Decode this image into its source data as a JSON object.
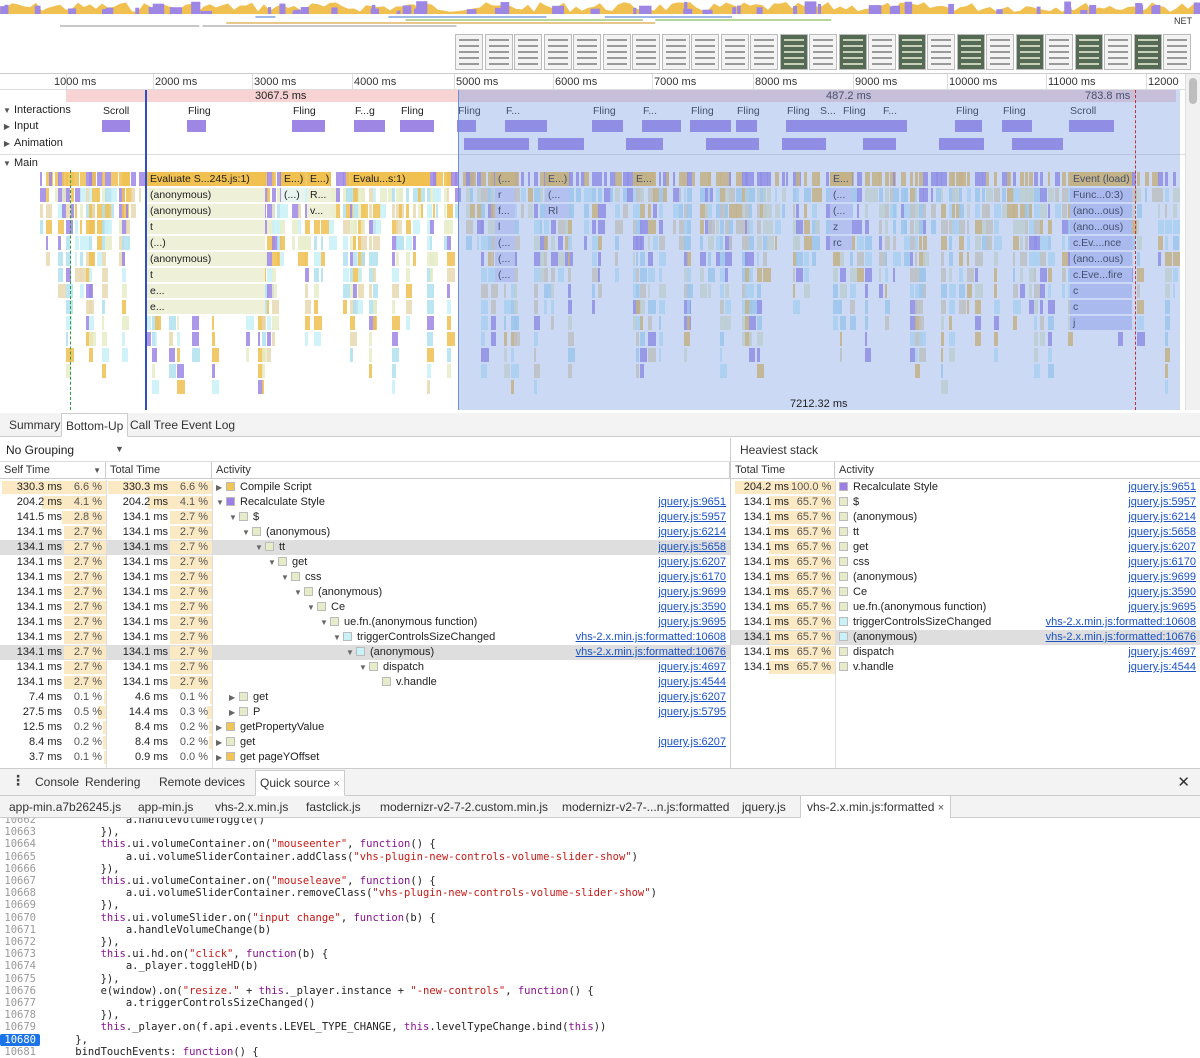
{
  "overview": {
    "net_label": "NET"
  },
  "ruler": {
    "ticks": [
      "1000 ms",
      "2000 ms",
      "3000 ms",
      "4000 ms",
      "5000 ms",
      "6000 ms",
      "7000 ms",
      "8000 ms",
      "9000 ms",
      "10000 ms",
      "11000 ms",
      "12000"
    ],
    "durations": [
      "3067.5 ms",
      "487.2 ms",
      "783.8 ms"
    ]
  },
  "tracks": {
    "interactions": "Interactions",
    "input": "Input",
    "animation": "Animation",
    "main": "Main",
    "interaction_labels": [
      "Scroll",
      "Fling",
      "Fling",
      "F...g",
      "Fling",
      "Fling",
      "F...",
      "Fling",
      "F...",
      "Fling",
      "Fling",
      "Fling",
      "S...",
      "Fling",
      "F...",
      "Fling",
      "Fling",
      "Scroll"
    ],
    "flame_labels": {
      "a": [
        "Evaluate S...245.js:1)",
        "(anonymous)",
        "(anonymous)",
        "t",
        "(...)",
        "(anonymous)",
        "t",
        "e...",
        "e..."
      ],
      "b": [
        "E...)",
        "(...)"
      ],
      "c": [
        "E...)",
        "R...",
        "v..."
      ],
      "d": [
        "Evalu...s:1)"
      ],
      "e": [
        "(...",
        "r",
        "f...",
        "l",
        "(...",
        "(...",
        "(..."
      ],
      "f": [
        "E...)",
        "(...",
        "Rl"
      ],
      "g": [
        "E..."
      ],
      "h": [
        "E...",
        "(...",
        "(...",
        "z",
        "rc"
      ],
      "i": [
        "Event (load)",
        "Func...0:3)",
        "(ano...ous)",
        "(ano...ous)",
        "c.Ev....nce",
        "(ano...ous)",
        "c.Eve...fire",
        "c",
        "c",
        "j"
      ]
    },
    "selection_duration": "7212.32 ms"
  },
  "panel_tabs": [
    "Summary",
    "Bottom-Up",
    "Call Tree",
    "Event Log"
  ],
  "grouping": "No Grouping",
  "bottom_up": {
    "headers": [
      "Self Time",
      "Total Time",
      "Activity"
    ],
    "rows": [
      {
        "self": "330.3 ms",
        "selfp": "6.6 %",
        "total": "330.3 ms",
        "totalp": "6.6 %",
        "indent": 0,
        "arrow": "▶",
        "color": "#f1c453",
        "name": "Compile Script",
        "link": ""
      },
      {
        "self": "204.2 ms",
        "selfp": "4.1 %",
        "total": "204.2 ms",
        "totalp": "4.1 %",
        "indent": 0,
        "arrow": "▼",
        "color": "#9b7fe6",
        "name": "Recalculate Style",
        "link": "jquery.js:9651"
      },
      {
        "self": "141.5 ms",
        "selfp": "2.8 %",
        "total": "134.1 ms",
        "totalp": "2.7 %",
        "indent": 1,
        "arrow": "▼",
        "color": "#e5ecc7",
        "name": "$",
        "link": "jquery.js:5957"
      },
      {
        "self": "134.1 ms",
        "selfp": "2.7 %",
        "total": "134.1 ms",
        "totalp": "2.7 %",
        "indent": 2,
        "arrow": "▼",
        "color": "#e5ecc7",
        "name": "(anonymous)",
        "link": "jquery.js:6214"
      },
      {
        "self": "134.1 ms",
        "selfp": "2.7 %",
        "total": "134.1 ms",
        "totalp": "2.7 %",
        "indent": 3,
        "arrow": "▼",
        "color": "#e5ecc7",
        "name": "tt",
        "link": "jquery.js:5658"
      },
      {
        "self": "134.1 ms",
        "selfp": "2.7 %",
        "total": "134.1 ms",
        "totalp": "2.7 %",
        "indent": 4,
        "arrow": "▼",
        "color": "#e5ecc7",
        "name": "get",
        "link": "jquery.js:6207"
      },
      {
        "self": "134.1 ms",
        "selfp": "2.7 %",
        "total": "134.1 ms",
        "totalp": "2.7 %",
        "indent": 5,
        "arrow": "▼",
        "color": "#e5ecc7",
        "name": "css",
        "link": "jquery.js:6170"
      },
      {
        "self": "134.1 ms",
        "selfp": "2.7 %",
        "total": "134.1 ms",
        "totalp": "2.7 %",
        "indent": 6,
        "arrow": "▼",
        "color": "#e5ecc7",
        "name": "(anonymous)",
        "link": "jquery.js:9699"
      },
      {
        "self": "134.1 ms",
        "selfp": "2.7 %",
        "total": "134.1 ms",
        "totalp": "2.7 %",
        "indent": 7,
        "arrow": "▼",
        "color": "#e5ecc7",
        "name": "Ce",
        "link": "jquery.js:3590"
      },
      {
        "self": "134.1 ms",
        "selfp": "2.7 %",
        "total": "134.1 ms",
        "totalp": "2.7 %",
        "indent": 8,
        "arrow": "▼",
        "color": "#e5ecc7",
        "name": "ue.fn.(anonymous function)",
        "link": "jquery.js:9695"
      },
      {
        "self": "134.1 ms",
        "selfp": "2.7 %",
        "total": "134.1 ms",
        "totalp": "2.7 %",
        "indent": 9,
        "arrow": "▼",
        "color": "#c8f1f8",
        "name": "triggerControlsSizeChanged",
        "link": "vhs-2.x.min.js:formatted:10608"
      },
      {
        "self": "134.1 ms",
        "selfp": "2.7 %",
        "total": "134.1 ms",
        "totalp": "2.7 %",
        "indent": 10,
        "arrow": "▼",
        "color": "#c8f1f8",
        "name": "(anonymous)",
        "link": "vhs-2.x.min.js:formatted:10676"
      },
      {
        "self": "134.1 ms",
        "selfp": "2.7 %",
        "total": "134.1 ms",
        "totalp": "2.7 %",
        "indent": 11,
        "arrow": "▼",
        "color": "#e5ecc7",
        "name": "dispatch",
        "link": "jquery.js:4697"
      },
      {
        "self": "134.1 ms",
        "selfp": "2.7 %",
        "total": "134.1 ms",
        "totalp": "2.7 %",
        "indent": 12,
        "arrow": "",
        "color": "#e5ecc7",
        "name": "v.handle",
        "link": "jquery.js:4544"
      },
      {
        "self": "7.4 ms",
        "selfp": "0.1 %",
        "total": "4.6 ms",
        "totalp": "0.1 %",
        "indent": 1,
        "arrow": "▶",
        "color": "#e5ecc7",
        "name": "get",
        "link": "jquery.js:6207"
      },
      {
        "self": "27.5 ms",
        "selfp": "0.5 %",
        "total": "14.4 ms",
        "totalp": "0.3 %",
        "indent": 1,
        "arrow": "▶",
        "color": "#e5ecc7",
        "name": "P",
        "link": "jquery.js:5795"
      },
      {
        "self": "12.5 ms",
        "selfp": "0.2 %",
        "total": "8.4 ms",
        "totalp": "0.2 %",
        "indent": 0,
        "arrow": "▶",
        "color": "#f1c453",
        "name": "getPropertyValue",
        "link": ""
      },
      {
        "self": "8.4 ms",
        "selfp": "0.2 %",
        "total": "8.4 ms",
        "totalp": "0.2 %",
        "indent": 0,
        "arrow": "▶",
        "color": "#e5ecc7",
        "name": "get",
        "link": "jquery.js:6207"
      },
      {
        "self": "3.7 ms",
        "selfp": "0.1 %",
        "total": "0.9 ms",
        "totalp": "0.0 %",
        "indent": 0,
        "arrow": "▶",
        "color": "#f1c453",
        "name": "get pageYOffset",
        "link": ""
      }
    ]
  },
  "heaviest": {
    "title": "Heaviest stack",
    "headers": [
      "Total Time",
      "Activity"
    ],
    "rows": [
      {
        "total": "204.2 ms",
        "pct": "100.0 %",
        "color": "#9b7fe6",
        "name": "Recalculate Style",
        "link": "jquery.js:9651"
      },
      {
        "total": "134.1 ms",
        "pct": "65.7 %",
        "color": "#e5ecc7",
        "name": "$",
        "link": "jquery.js:5957"
      },
      {
        "total": "134.1 ms",
        "pct": "65.7 %",
        "color": "#e5ecc7",
        "name": "(anonymous)",
        "link": "jquery.js:6214"
      },
      {
        "total": "134.1 ms",
        "pct": "65.7 %",
        "color": "#e5ecc7",
        "name": "tt",
        "link": "jquery.js:5658"
      },
      {
        "total": "134.1 ms",
        "pct": "65.7 %",
        "color": "#e5ecc7",
        "name": "get",
        "link": "jquery.js:6207"
      },
      {
        "total": "134.1 ms",
        "pct": "65.7 %",
        "color": "#e5ecc7",
        "name": "css",
        "link": "jquery.js:6170"
      },
      {
        "total": "134.1 ms",
        "pct": "65.7 %",
        "color": "#e5ecc7",
        "name": "(anonymous)",
        "link": "jquery.js:9699"
      },
      {
        "total": "134.1 ms",
        "pct": "65.7 %",
        "color": "#e5ecc7",
        "name": "Ce",
        "link": "jquery.js:3590"
      },
      {
        "total": "134.1 ms",
        "pct": "65.7 %",
        "color": "#e5ecc7",
        "name": "ue.fn.(anonymous function)",
        "link": "jquery.js:9695"
      },
      {
        "total": "134.1 ms",
        "pct": "65.7 %",
        "color": "#c8f1f8",
        "name": "triggerControlsSizeChanged",
        "link": "vhs-2.x.min.js:formatted:10608"
      },
      {
        "total": "134.1 ms",
        "pct": "65.7 %",
        "color": "#c8f1f8",
        "name": "(anonymous)",
        "link": "vhs-2.x.min.js:formatted:10676"
      },
      {
        "total": "134.1 ms",
        "pct": "65.7 %",
        "color": "#e5ecc7",
        "name": "dispatch",
        "link": "jquery.js:4697"
      },
      {
        "total": "134.1 ms",
        "pct": "65.7 %",
        "color": "#e5ecc7",
        "name": "v.handle",
        "link": "jquery.js:4544"
      }
    ]
  },
  "drawer": {
    "tabs": [
      "Console",
      "Rendering",
      "Remote devices",
      "Quick source"
    ],
    "active_close": "×",
    "close": "✕"
  },
  "file_tabs": [
    "app-min.a7b26245.js",
    "app-min.js",
    "vhs-2.x.min.js",
    "fastclick.js",
    "modernizr-v2-7-2.custom.min.js",
    "modernizr-v2-7-...n.js:formatted",
    "jquery.js",
    "vhs-2.x.min.js:formatted"
  ],
  "code": {
    "current_line": "10680",
    "lines": [
      {
        "n": "10662",
        "t": "            a.handleVolumeToggle()"
      },
      {
        "n": "10663",
        "t": "        }),"
      },
      {
        "n": "10664",
        "t": "        this.ui.volumeContainer.on(\"mouseenter\", function() {"
      },
      {
        "n": "10665",
        "t": "            a.ui.volumeSliderContainer.addClass(\"vhs-plugin-new-controls-volume-slider-show\")"
      },
      {
        "n": "10666",
        "t": "        }),"
      },
      {
        "n": "10667",
        "t": "        this.ui.volumeContainer.on(\"mouseleave\", function() {"
      },
      {
        "n": "10668",
        "t": "            a.ui.volumeSliderContainer.removeClass(\"vhs-plugin-new-controls-volume-slider-show\")"
      },
      {
        "n": "10669",
        "t": "        }),"
      },
      {
        "n": "10670",
        "t": "        this.ui.volumeSlider.on(\"input change\", function(b) {"
      },
      {
        "n": "10671",
        "t": "            a.handleVolumeChange(b)"
      },
      {
        "n": "10672",
        "t": "        }),"
      },
      {
        "n": "10673",
        "t": "        this.ui.hd.on(\"click\", function(b) {"
      },
      {
        "n": "10674",
        "t": "            a._player.toggleHD(b)"
      },
      {
        "n": "10675",
        "t": "        }),"
      },
      {
        "n": "10676",
        "t": "        e(window).on(\"resize.\" + this._player.instance + \"-new-controls\", function() {"
      },
      {
        "n": "10677",
        "t": "            a.triggerControlsSizeChanged()"
      },
      {
        "n": "10678",
        "t": "        }),"
      },
      {
        "n": "10679",
        "t": "        this._player.on(f.api.events.LEVEL_TYPE_CHANGE, this.levelTypeChange.bind(this))"
      },
      {
        "n": "10680",
        "t": "    },"
      },
      {
        "n": "10681",
        "t": "    bindTouchEvents: function() {"
      }
    ]
  }
}
